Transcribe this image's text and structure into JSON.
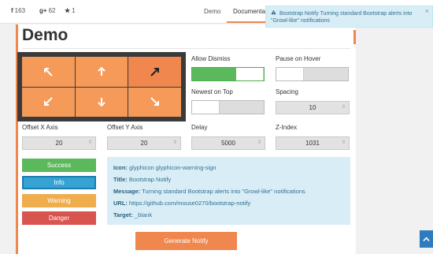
{
  "topbar": {
    "facebook": {
      "icon": "facebook-icon",
      "glyph": "f",
      "count": "163"
    },
    "googleplus": {
      "icon": "google-plus-icon",
      "glyph": "g+",
      "count": "62"
    },
    "star": {
      "icon": "star-icon",
      "glyph": "★",
      "count": "1"
    },
    "nav": [
      "Demo",
      "Documentat"
    ]
  },
  "alert": {
    "text": "Bootstrap Notify Turning standard Bootstrap alerts into \"Growl-like\" notifications",
    "close": "×"
  },
  "page": {
    "title": "Demo"
  },
  "position_grid": {
    "selected_index": 2,
    "cells": [
      "arrow-up-left-icon",
      "arrow-up-icon",
      "arrow-up-right-icon",
      "arrow-down-left-icon",
      "arrow-down-icon",
      "arrow-down-right-icon"
    ]
  },
  "options": {
    "allow_dismiss": {
      "label": "Allow Dismiss",
      "on": true
    },
    "pause_on_hover": {
      "label": "Pause on Hover",
      "on": false
    },
    "newest_on_top": {
      "label": "Newest on Top",
      "on": false
    },
    "spacing": {
      "label": "Spacing",
      "value": "10"
    },
    "offset_x": {
      "label": "Offset X Axis",
      "value": "20"
    },
    "offset_y": {
      "label": "Offset Y Axis",
      "value": "20"
    },
    "delay": {
      "label": "Delay",
      "value": "5000"
    },
    "z_index": {
      "label": "Z-Index",
      "value": "1031"
    }
  },
  "types": {
    "success": "Success",
    "info": "Info",
    "warning": "Warning",
    "danger": "Danger",
    "selected": "info"
  },
  "details": {
    "icon_label": "Icon:",
    "icon_value": "glyphicon glyphicon-warning-sign",
    "title_label": "Title:",
    "title_value": "Bootstrap Notify",
    "message_label": "Message:",
    "message_value": "Turning standard Bootstrap alerts into \"Growl-like\" notifications",
    "url_label": "URL:",
    "url_value": "https://github.com/mouse0270/bootstrap-notify",
    "target_label": "Target:",
    "target_value": "_blank"
  },
  "actions": {
    "generate": "Generate Notify"
  },
  "colors": {
    "accent": "#f0874e",
    "success": "#5cb85c",
    "info": "#36a3d4",
    "warning": "#f0ad4e",
    "danger": "#d9534f"
  }
}
